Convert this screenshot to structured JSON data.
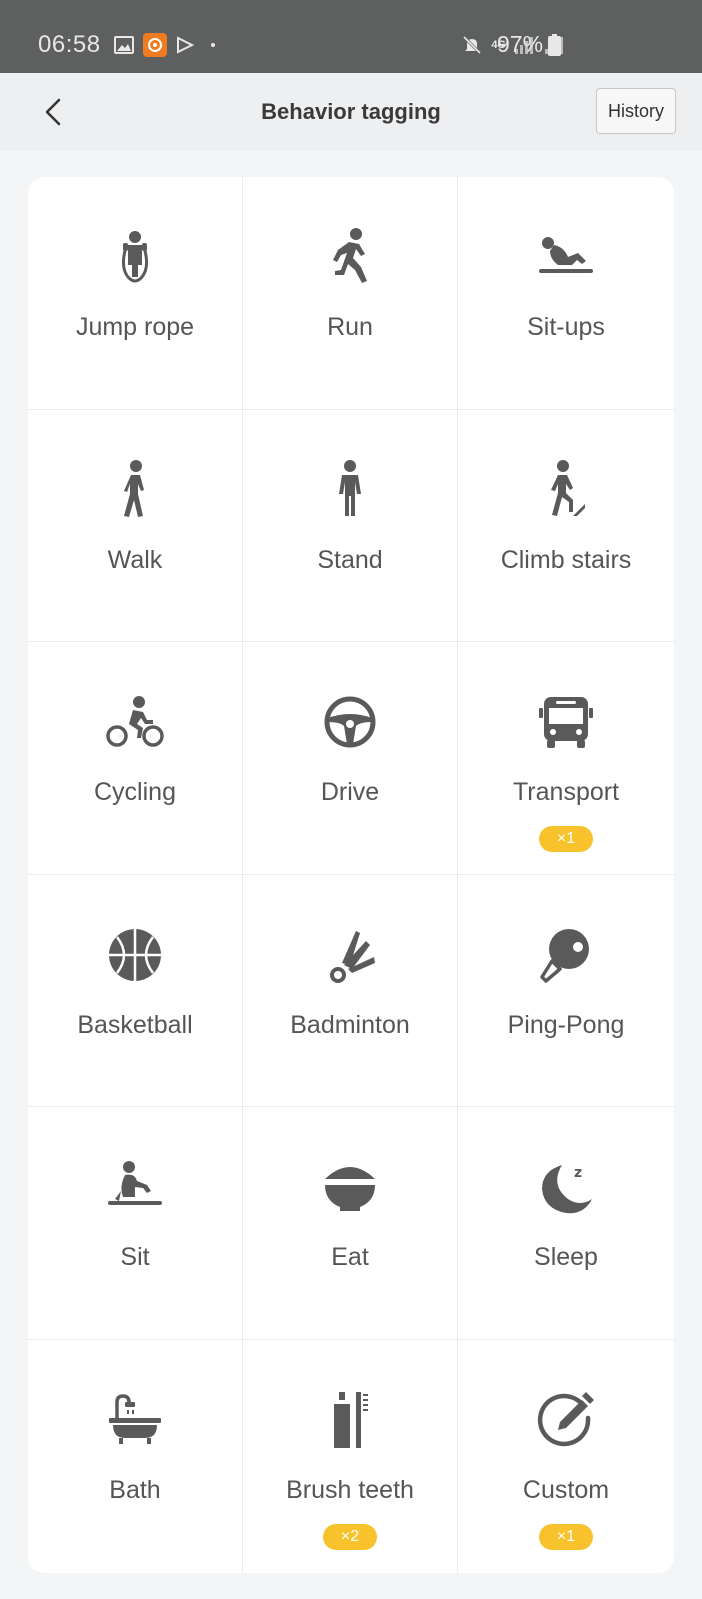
{
  "status_bar": {
    "time": "06:58",
    "network": "4G",
    "battery": "97%"
  },
  "header": {
    "title": "Behavior tagging",
    "history_label": "History"
  },
  "colors": {
    "accent_badge": "#f7c22b",
    "icon": "#5a5a5a",
    "status_bar_bg": "#5e5f5f"
  },
  "tiles": [
    {
      "label": "Jump rope",
      "icon": "jump-rope-icon",
      "badge": ""
    },
    {
      "label": "Run",
      "icon": "run-icon",
      "badge": ""
    },
    {
      "label": "Sit-ups",
      "icon": "sit-ups-icon",
      "badge": ""
    },
    {
      "label": "Walk",
      "icon": "walk-icon",
      "badge": ""
    },
    {
      "label": "Stand",
      "icon": "stand-icon",
      "badge": ""
    },
    {
      "label": "Climb stairs",
      "icon": "climb-stairs-icon",
      "badge": ""
    },
    {
      "label": "Cycling",
      "icon": "cycling-icon",
      "badge": ""
    },
    {
      "label": "Drive",
      "icon": "steering-wheel-icon",
      "badge": ""
    },
    {
      "label": "Transport",
      "icon": "bus-icon",
      "badge": "×1"
    },
    {
      "label": "Basketball",
      "icon": "basketball-icon",
      "badge": ""
    },
    {
      "label": "Badminton",
      "icon": "shuttlecock-icon",
      "badge": ""
    },
    {
      "label": "Ping-Pong",
      "icon": "ping-pong-paddle-icon",
      "badge": ""
    },
    {
      "label": "Sit",
      "icon": "sit-icon",
      "badge": ""
    },
    {
      "label": "Eat",
      "icon": "bowl-icon",
      "badge": ""
    },
    {
      "label": "Sleep",
      "icon": "moon-icon",
      "badge": ""
    },
    {
      "label": "Bath",
      "icon": "bathtub-icon",
      "badge": ""
    },
    {
      "label": "Brush teeth",
      "icon": "toothbrush-icon",
      "badge": "×2"
    },
    {
      "label": "Custom",
      "icon": "edit-pencil-icon",
      "badge": "×1"
    }
  ]
}
